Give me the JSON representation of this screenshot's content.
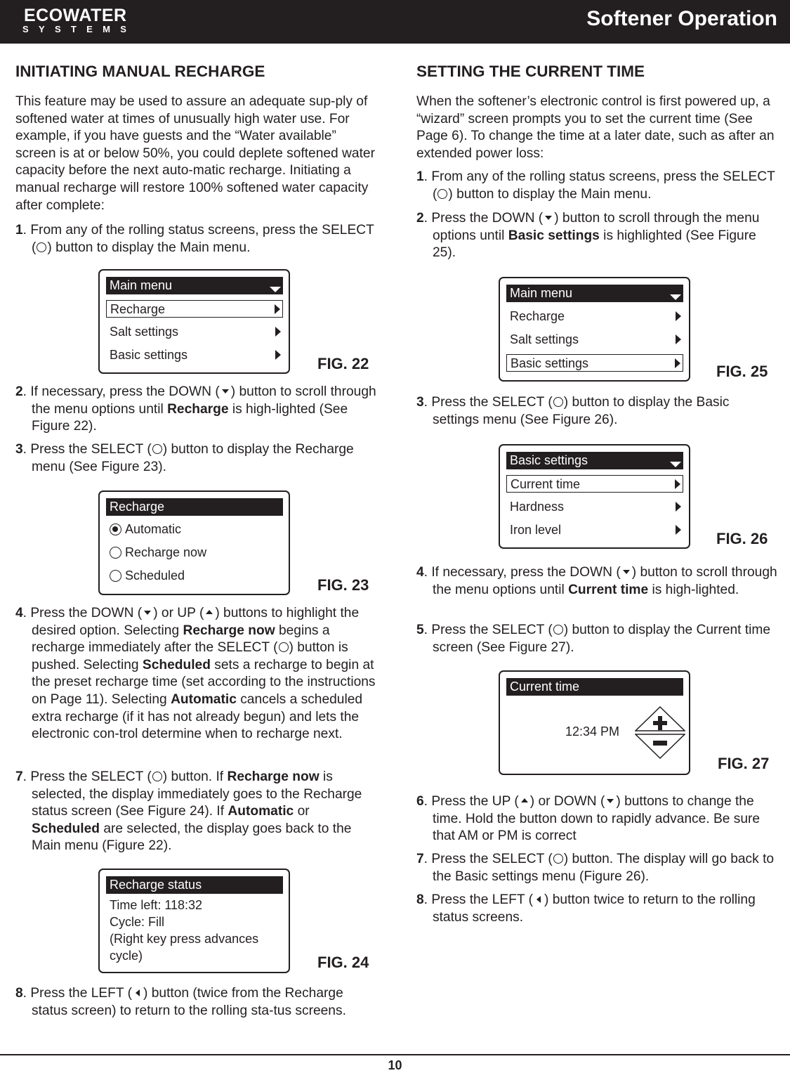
{
  "header": {
    "logo_main": "ECOWATER",
    "logo_sub": "SYSTEMS",
    "title": "Softener Operation"
  },
  "left": {
    "heading": "INITIATING MANUAL RECHARGE",
    "intro": [
      {
        "t": "This feature may be used to assure an adequate sup-ply of softened water at times of unusually high water use.  For example, if you have guests and the “Water available” screen is at or below 50%, you could deplete softened water capacity before the next auto-matic recharge.  Initiating a manual recharge will restore 100% softened water capacity after complete:"
      }
    ],
    "step1": [
      {
        "t": "1",
        "b": 1
      },
      {
        "t": ". From any of the rolling status screens, press the SELECT ("
      },
      {
        "i": "circ"
      },
      {
        "t": ") button to display the Main menu."
      }
    ],
    "step2": [
      {
        "t": "2",
        "b": 1
      },
      {
        "t": ". If necessary, press the DOWN ("
      },
      {
        "i": "down"
      },
      {
        "t": ") button to scroll through the menu options until "
      },
      {
        "t": "Recharge",
        "b": 1
      },
      {
        "t": " is high-lighted (See Figure 22)."
      }
    ],
    "step3": [
      {
        "t": "3",
        "b": 1
      },
      {
        "t": ". Press the SELECT ("
      },
      {
        "i": "circ"
      },
      {
        "t": ") button to display the Recharge menu (See Figure 23)."
      }
    ],
    "step4": [
      {
        "t": "4",
        "b": 1
      },
      {
        "t": ". Press the DOWN ("
      },
      {
        "i": "down"
      },
      {
        "t": ") or UP ("
      },
      {
        "i": "up"
      },
      {
        "t": ") buttons to highlight the desired option.  Selecting "
      },
      {
        "t": "Recharge now",
        "b": 1
      },
      {
        "t": " begins a recharge immediately after the SELECT ("
      },
      {
        "i": "circ"
      },
      {
        "t": ") button is pushed.  Selecting "
      },
      {
        "t": "Scheduled",
        "b": 1
      },
      {
        "t": " sets a recharge to begin at the preset recharge time (set according to the instructions on Page 11).  Selecting "
      },
      {
        "t": "Automatic",
        "b": 1
      },
      {
        "t": " cancels a scheduled extra recharge (if it has not already begun) and lets the electronic con-trol determine when to recharge next."
      }
    ],
    "step7": [
      {
        "t": "7",
        "b": 1
      },
      {
        "t": ". Press the SELECT ("
      },
      {
        "i": "circ"
      },
      {
        "t": ") button.  If "
      },
      {
        "t": "Recharge now",
        "b": 1
      },
      {
        "t": " is selected, the display immediately goes to the Recharge status screen (See Figure 24).  If "
      },
      {
        "t": "Automatic",
        "b": 1
      },
      {
        "t": " or "
      },
      {
        "t": "Scheduled",
        "b": 1
      },
      {
        "t": " are selected, the display goes back to the Main menu (Figure 22)."
      }
    ],
    "step8": [
      {
        "t": "8",
        "b": 1
      },
      {
        "t": ". Press the LEFT ("
      },
      {
        "i": "left"
      },
      {
        "t": ") button (twice from the Recharge status screen) to return to the rolling sta-tus screens."
      }
    ],
    "fig22": {
      "label": "FIG. 22",
      "title": "Main menu",
      "items": [
        "Recharge",
        "Salt settings",
        "Basic settings"
      ]
    },
    "fig23": {
      "label": "FIG. 23",
      "title": "Recharge",
      "options": [
        "Automatic",
        "Recharge now",
        "Scheduled"
      ],
      "selected": "Automatic"
    },
    "fig24": {
      "label": "FIG. 24",
      "title": "Recharge status",
      "lines": [
        "Time left: 118:32",
        "Cycle: Fill",
        "(Right key press advances",
        "cycle)"
      ]
    }
  },
  "right": {
    "heading": "SETTING THE CURRENT TIME",
    "intro": [
      {
        "t": "When the softener’s electronic control is first powered up, a “wizard” screen prompts you to set the current time (See Page 6).  To change the time at a later date, such as after an extended power loss:"
      }
    ],
    "step1": [
      {
        "t": "1",
        "b": 1
      },
      {
        "t": ". From any of the rolling status screens, press the SELECT ("
      },
      {
        "i": "circ"
      },
      {
        "t": ") button to display the Main menu."
      }
    ],
    "step2": [
      {
        "t": "2",
        "b": 1
      },
      {
        "t": ". Press the DOWN ("
      },
      {
        "i": "down"
      },
      {
        "t": ") button to scroll through the menu options until "
      },
      {
        "t": "Basic settings",
        "b": 1
      },
      {
        "t": " is highlighted (See Figure 25)."
      }
    ],
    "step3": [
      {
        "t": "3",
        "b": 1
      },
      {
        "t": ". Press the SELECT ("
      },
      {
        "i": "circ"
      },
      {
        "t": ") button to display the Basic settings menu (See Figure 26)."
      }
    ],
    "step4": [
      {
        "t": "4",
        "b": 1
      },
      {
        "t": ". If necessary, press the DOWN ("
      },
      {
        "i": "down"
      },
      {
        "t": ") button to scroll through the menu options until "
      },
      {
        "t": "Current time",
        "b": 1
      },
      {
        "t": " is high-lighted."
      }
    ],
    "step5": [
      {
        "t": "5",
        "b": 1
      },
      {
        "t": ". Press the SELECT ("
      },
      {
        "i": "circ"
      },
      {
        "t": ") button to display the Current time screen (See Figure 27)."
      }
    ],
    "step6": [
      {
        "t": "6",
        "b": 1
      },
      {
        "t": ". Press the UP ("
      },
      {
        "i": "up"
      },
      {
        "t": ") or DOWN ("
      },
      {
        "i": "down"
      },
      {
        "t": ") buttons to change the time.  Hold the button down to rapidly advance.  Be sure that AM or PM is correct"
      }
    ],
    "step7": [
      {
        "t": "7",
        "b": 1
      },
      {
        "t": ". Press the SELECT ("
      },
      {
        "i": "circ"
      },
      {
        "t": ") button.  The display will go back to the Basic settings menu (Figure 26)."
      }
    ],
    "step8": [
      {
        "t": "8",
        "b": 1
      },
      {
        "t": ". Press the LEFT ("
      },
      {
        "i": "left"
      },
      {
        "t": ") button twice to return to the rolling status screens."
      }
    ],
    "fig25": {
      "label": "FIG. 25",
      "title": "Main menu",
      "items": [
        "Recharge",
        "Salt settings",
        "Basic settings"
      ]
    },
    "fig26": {
      "label": "FIG. 26",
      "title": "Basic settings",
      "items": [
        "Current time",
        "Hardness",
        "Iron level"
      ]
    },
    "fig27": {
      "label": "FIG. 27",
      "title": "Current time",
      "time": "12:34 PM"
    }
  },
  "footer": {
    "page_number": "10"
  }
}
